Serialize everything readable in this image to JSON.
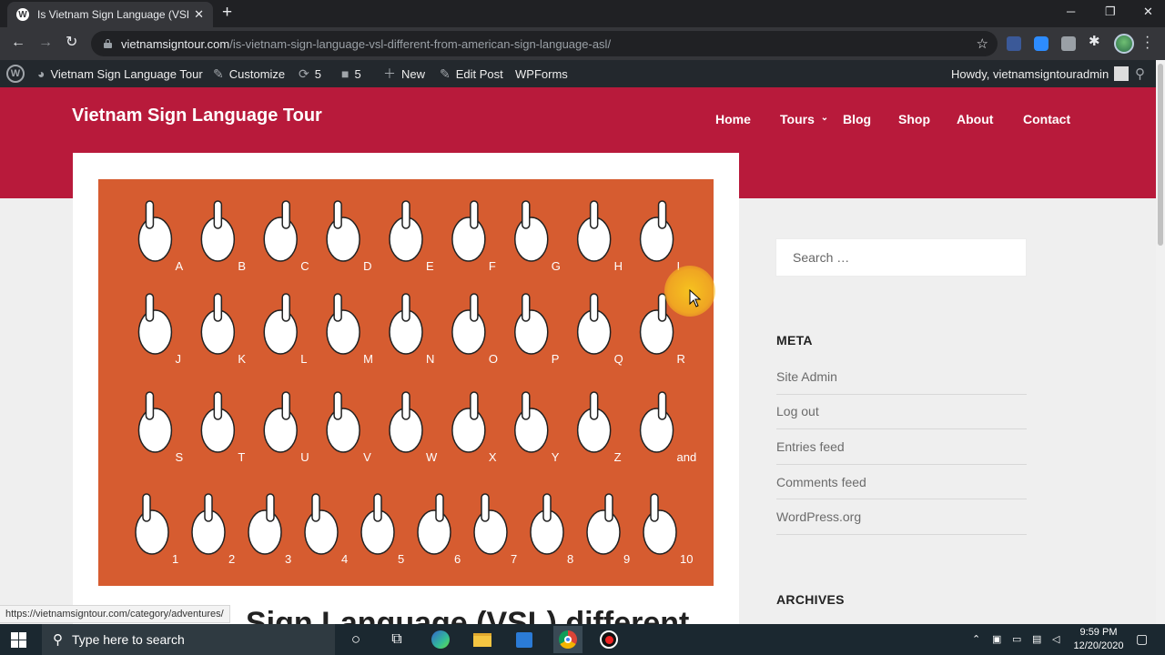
{
  "browser": {
    "tab_title": "Is Vietnam Sign Language (VSL) d",
    "favicon": "W",
    "new_tab": "+",
    "url_host": "vietnamsigntour.com",
    "url_path": "/is-vietnam-sign-language-vsl-different-from-american-sign-language-asl/"
  },
  "adminbar": {
    "site": "Vietnam Sign Language Tour",
    "customize": "Customize",
    "updates": "5",
    "comments": "5",
    "new": "New",
    "edit_post": "Edit Post",
    "wpforms": "WPForms",
    "howdy": "Howdy, vietnamsigntouradmin"
  },
  "site": {
    "title": "Vietnam Sign Language Tour",
    "nav": [
      "Home",
      "Tours",
      "Blog",
      "Shop",
      "About",
      "Contact"
    ],
    "brand_color": "#b81a3b"
  },
  "post": {
    "title_partial": "Sign Language (VSL) different",
    "image": {
      "background": "#d65c30",
      "letters_row1": [
        "A",
        "B",
        "C",
        "D",
        "E",
        "F",
        "G",
        "H",
        "I"
      ],
      "letters_row2": [
        "J",
        "K",
        "L",
        "M",
        "N",
        "O",
        "P",
        "Q",
        "R"
      ],
      "letters_row3": [
        "S",
        "T",
        "U",
        "V",
        "W",
        "X",
        "Y",
        "Z",
        "and"
      ],
      "numbers_row4": [
        "1",
        "2",
        "3",
        "4",
        "5",
        "6",
        "7",
        "8",
        "9",
        "10"
      ]
    }
  },
  "sidebar": {
    "search_placeholder": "Search …",
    "meta_title": "META",
    "meta_links": [
      "Site Admin",
      "Log out",
      "Entries feed",
      "Comments feed",
      "WordPress.org"
    ],
    "archives_title": "ARCHIVES"
  },
  "status_bar": {
    "link": "https://vietnamsigntour.com/category/adventures/"
  },
  "taskbar": {
    "search_placeholder": "Type here to search",
    "time": "9:59 PM",
    "date": "12/20/2020"
  }
}
